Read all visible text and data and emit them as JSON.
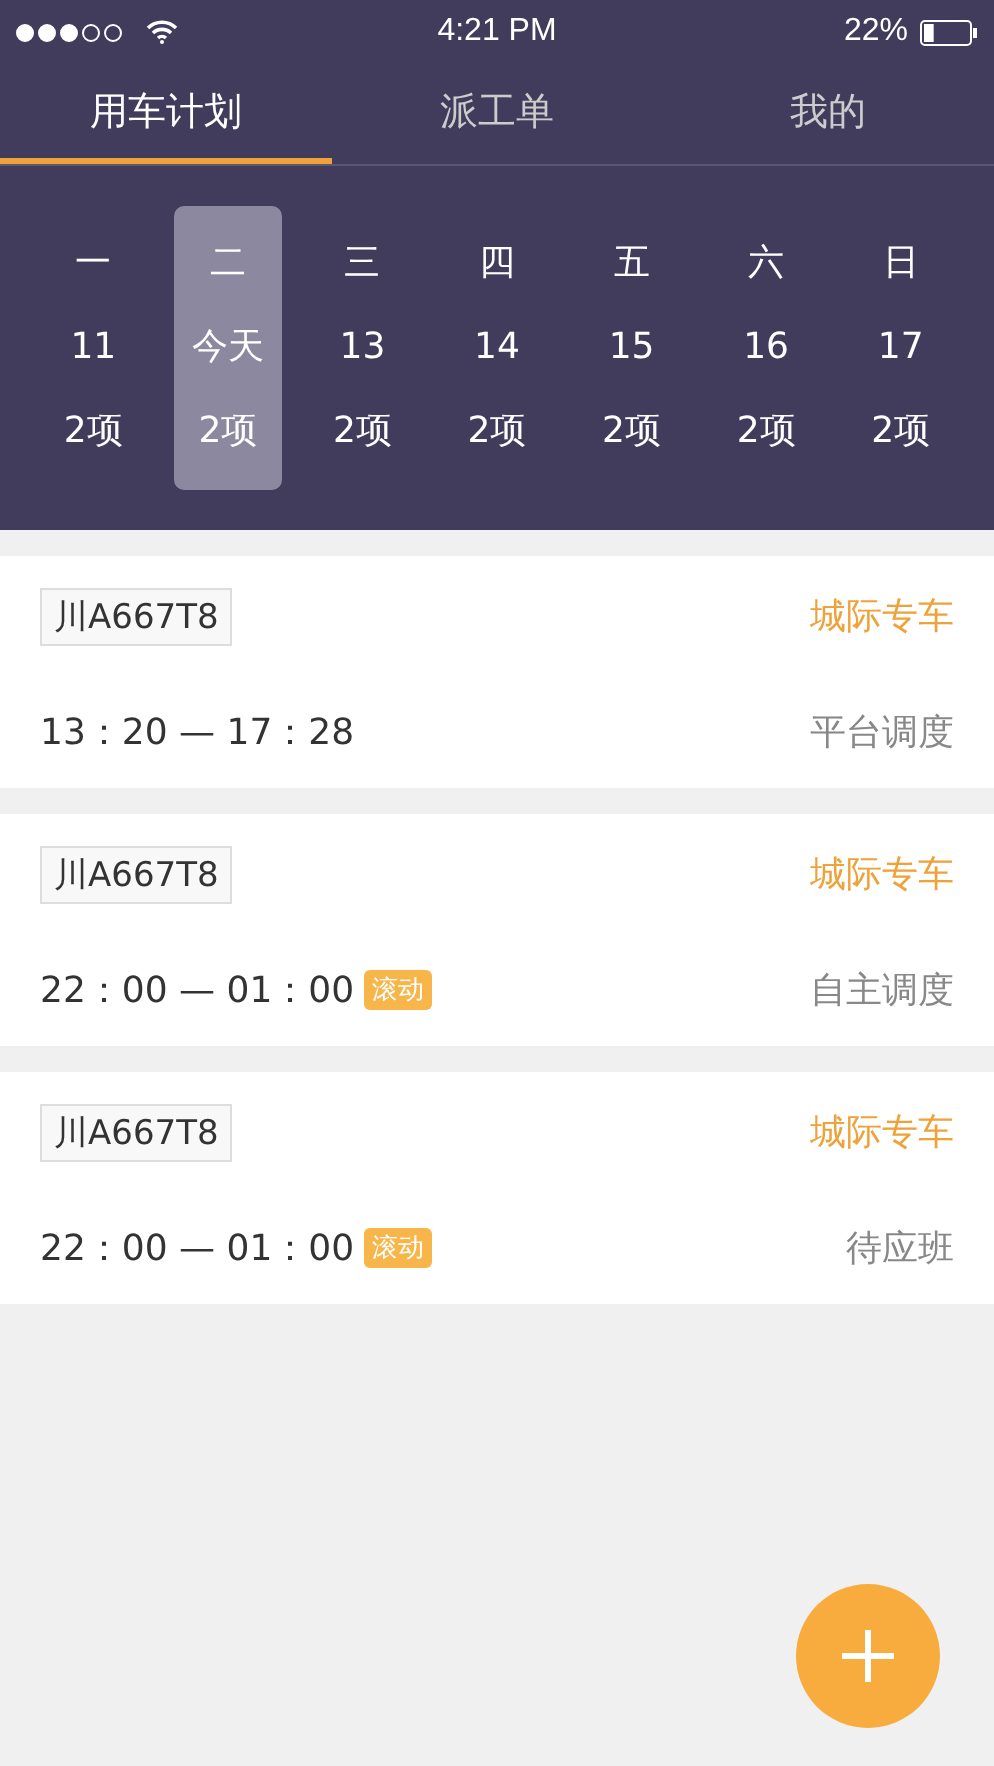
{
  "status_bar": {
    "time": "4:21 PM",
    "battery": "22%"
  },
  "tabs": [
    {
      "label": "用车计划",
      "selected": true
    },
    {
      "label": "派工单",
      "selected": false
    },
    {
      "label": "我的",
      "selected": false
    }
  ],
  "week": [
    {
      "weekday": "一",
      "date": "11",
      "count": "2项",
      "selected": false
    },
    {
      "weekday": "二",
      "date": "今天",
      "count": "2项",
      "selected": true
    },
    {
      "weekday": "三",
      "date": "13",
      "count": "2项",
      "selected": false
    },
    {
      "weekday": "四",
      "date": "14",
      "count": "2项",
      "selected": false
    },
    {
      "weekday": "五",
      "date": "15",
      "count": "2项",
      "selected": false
    },
    {
      "weekday": "六",
      "date": "16",
      "count": "2项",
      "selected": false
    },
    {
      "weekday": "日",
      "date": "17",
      "count": "2项",
      "selected": false
    }
  ],
  "trips": [
    {
      "plate": "川A667T8",
      "type": "城际专车",
      "time": "13：20 — 17：28",
      "dispatch": "平台调度"
    },
    {
      "plate": "川A667T8",
      "type": "城际专车",
      "time": "22：00 — 01：00",
      "tag": "滚动",
      "dispatch": "自主调度"
    },
    {
      "plate": "川A667T8",
      "type": "城际专车",
      "time": "22：00 — 01：00",
      "tag": "滚动",
      "dispatch": "待应班"
    }
  ]
}
